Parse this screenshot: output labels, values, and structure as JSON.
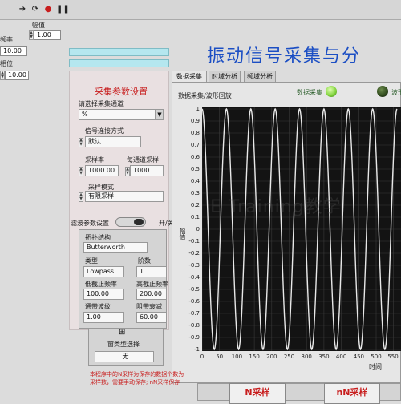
{
  "toolbar": {
    "icons": [
      "run-arrow-icon",
      "run-continuous-icon",
      "abort-icon",
      "pause-icon"
    ]
  },
  "controls_left": {
    "amplitude_label": "幅值",
    "amplitude_value": "1.00",
    "frequency_label": "频率",
    "frequency_value": "10.00",
    "phase_label": "相位",
    "phase_value": "10.00"
  },
  "title": "振动信号采集与分",
  "acq_params": {
    "heading": "采集参数设置",
    "channel_label": "请选择采集通道",
    "channel_value": "%",
    "conn_label": "信号连接方式",
    "conn_value": "默认",
    "rate_label": "采样率",
    "rate_value": "1000.00",
    "per_channel_label": "每通道采样",
    "per_channel_value": "1000",
    "mode_label": "采样模式",
    "mode_value": "有限采样"
  },
  "filter": {
    "toggle_label": "滤波参数设置",
    "toggle_state": "开/关",
    "topology_label": "拓扑结构",
    "topology_value": "Butterworth",
    "type_label": "类型",
    "type_value": "Lowpass",
    "order_label": "阶数",
    "order_value": "1",
    "low_cut_label": "低截止频率",
    "low_cut_value": "100.00",
    "high_cut_label": "高截止频率",
    "high_cut_value": "200.00",
    "ripple_label": "通带波纹",
    "ripple_value": "1.00",
    "atten_label": "阻带衰减",
    "atten_value": "60.00"
  },
  "window_select": {
    "label": "窗类型选择",
    "value": "无"
  },
  "tabs": [
    "数据采集",
    "时域分析",
    "频域分析"
  ],
  "plot": {
    "caption": "数据采集/波形回放",
    "led1_label": "数据采集",
    "led2_label": "波形",
    "led1_color": "#7fd23a",
    "led2_color": "#2f4a1c",
    "trace_color": "#e8e8e8"
  },
  "watermark": "E Training教学",
  "bottom": {
    "note_line1": "本程序中的N采样为保存的数据个数为",
    "note_line2": "采样数，需要手动保存; nN采样保存",
    "n_sample_label": "N采样",
    "nn_sample_label": "nN采样"
  },
  "chart_data": {
    "type": "line",
    "xlabel": "时间",
    "ylabel": "幅值",
    "xlim": [
      0,
      560
    ],
    "ylim": [
      -1,
      1
    ],
    "x_ticks": [
      "0",
      "50",
      "100",
      "150",
      "200",
      "250",
      "300",
      "350",
      "400",
      "450",
      "500",
      "550"
    ],
    "y_ticks": [
      "1",
      "0.9",
      "0.8",
      "0.7",
      "0.6",
      "0.5",
      "0.4",
      "0.3",
      "0.2",
      "0.1",
      "0",
      "-0.1",
      "-0.2",
      "-0.3",
      "-0.4",
      "-0.5",
      "-0.6",
      "-0.7",
      "-0.8",
      "-0.9",
      "-1"
    ],
    "series": [
      {
        "amplitude": 1.0,
        "period": 70,
        "phase_deg": 90,
        "x_start": 0,
        "x_end": 560
      }
    ]
  }
}
